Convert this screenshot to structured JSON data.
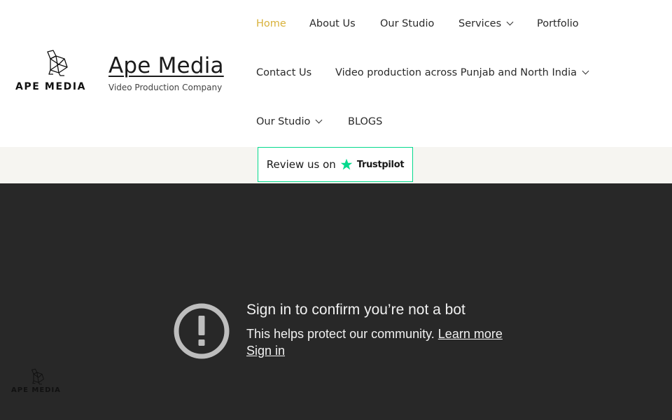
{
  "brand": {
    "logo_text": "APE MEDIA",
    "title": "Ape Media",
    "tagline": "Video Production Company"
  },
  "nav": {
    "home": "Home",
    "about": "About Us",
    "studio": "Our Studio",
    "services": "Services",
    "portfolio": "Portfolio",
    "contact": "Contact Us",
    "video_production": "Video production across Punjab and North India",
    "studio_2": "Our Studio",
    "blogs": "BLOGS",
    "active_color": "#d8b13a"
  },
  "trustpilot": {
    "label": "Review us on",
    "brand": "Trustpilot",
    "star_color": "#04da8d"
  },
  "video_embed": {
    "title": "Sign in to confirm you’re not a bot",
    "subtitle": "This helps protect our community.",
    "learn_more": "Learn more",
    "sign_in": "Sign in",
    "icon": "exclamation-circle-icon"
  },
  "floating_logo": {
    "text": "APE MEDIA"
  }
}
